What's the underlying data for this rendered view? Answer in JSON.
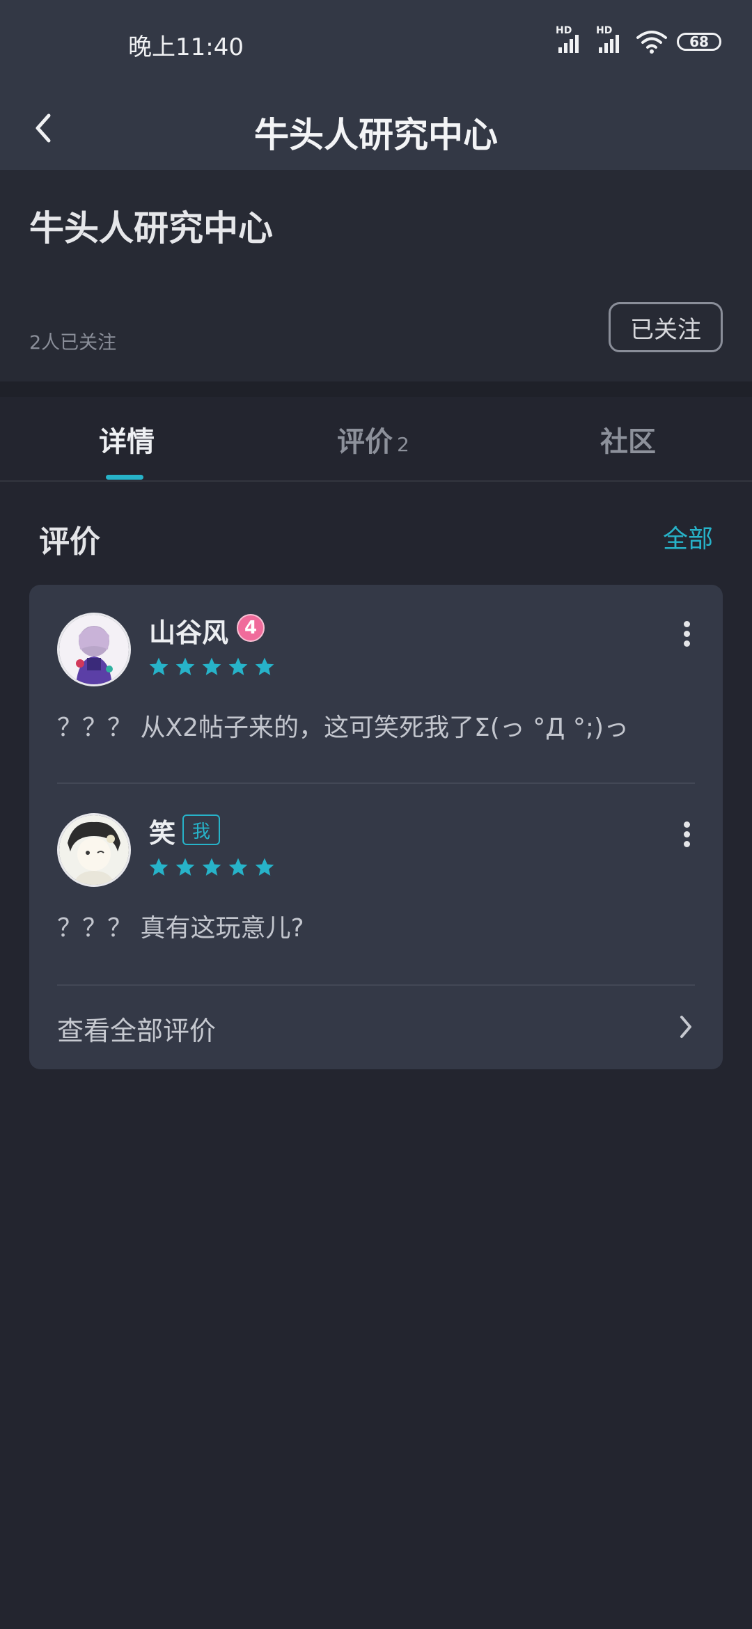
{
  "status_bar": {
    "time": "晚上11:40",
    "signal1_label": "HD",
    "signal2_label": "HD",
    "battery": "68"
  },
  "nav": {
    "title": "牛头人研究中心"
  },
  "header": {
    "group_name": "牛头人研究中心",
    "followers": "2人已关注",
    "follow_button": "已关注"
  },
  "tabs": [
    {
      "label": "详情"
    },
    {
      "label": "评价",
      "count": "2"
    },
    {
      "label": "社区"
    }
  ],
  "reviews_section": {
    "title": "评价",
    "all_link": "全部",
    "items": [
      {
        "username": "山谷风",
        "level": "4",
        "rating": 5,
        "text": "？？？ 从X2帖子来的，这可笑死我了Σ(っ °Д °;)っ"
      },
      {
        "username": "笑",
        "badge": "我",
        "rating": 5,
        "text": "？？？ 真有这玩意儿?"
      }
    ],
    "view_all": "查看全部评价"
  },
  "colors": {
    "accent": "#27b3c9",
    "level_badge": "#f06b9b",
    "background": "#23252f",
    "card": "#343947"
  }
}
